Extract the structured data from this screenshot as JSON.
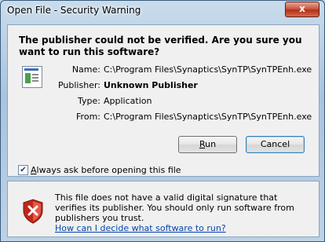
{
  "window": {
    "title": "Open File - Security Warning",
    "close_glyph": "x"
  },
  "header": {
    "headline": "The publisher could not be verified.  Are you sure you want to run this software?"
  },
  "details": [
    {
      "label": "Name:",
      "value": "C:\\Program Files\\Synaptics\\SynTP\\SynTPEnh.exe",
      "bold": false
    },
    {
      "label": "Publisher:",
      "value": "Unknown Publisher",
      "bold": true
    },
    {
      "label": "Type:",
      "value": "Application",
      "bold": false
    },
    {
      "label": "From:",
      "value": "C:\\Program Files\\Synaptics\\SynTP\\SynTPEnh.exe",
      "bold": false
    }
  ],
  "buttons": {
    "run": {
      "mnemonic": "R",
      "rest": "un"
    },
    "cancel": "Cancel"
  },
  "checkbox": {
    "checked": true,
    "mnemonic": "A",
    "rest": "lways ask before opening this file"
  },
  "warning": {
    "text": "This file does not have a valid digital signature that verifies its publisher.  You should only run software from publishers you trust.",
    "link": "How can I decide what software to run?"
  },
  "icons": {
    "file": "application-file-icon",
    "shield": "security-shield-error-icon"
  },
  "colors": {
    "link": "#0645ad",
    "shield_red": "#c0261b"
  }
}
